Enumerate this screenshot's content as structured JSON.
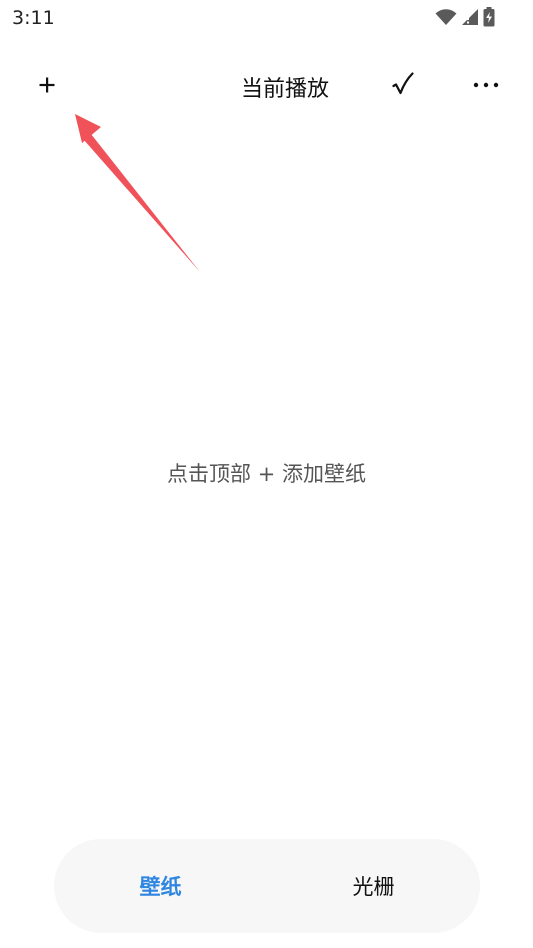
{
  "status_bar": {
    "time": "3:11",
    "icons": [
      "wifi-icon",
      "signal-icon",
      "battery-charging-icon"
    ]
  },
  "header": {
    "add_label": "+",
    "title": "当前播放",
    "confirm_label": "✓",
    "more_label": "⋯"
  },
  "main": {
    "empty_hint": "点击顶部 + 添加壁纸"
  },
  "tabs": [
    {
      "label": "壁纸",
      "active": true
    },
    {
      "label": "光栅",
      "active": false
    }
  ],
  "colors": {
    "accent": "#2f86e0",
    "annotation_arrow": "#f0525a",
    "tab_bar_bg": "#f7f7f7"
  }
}
